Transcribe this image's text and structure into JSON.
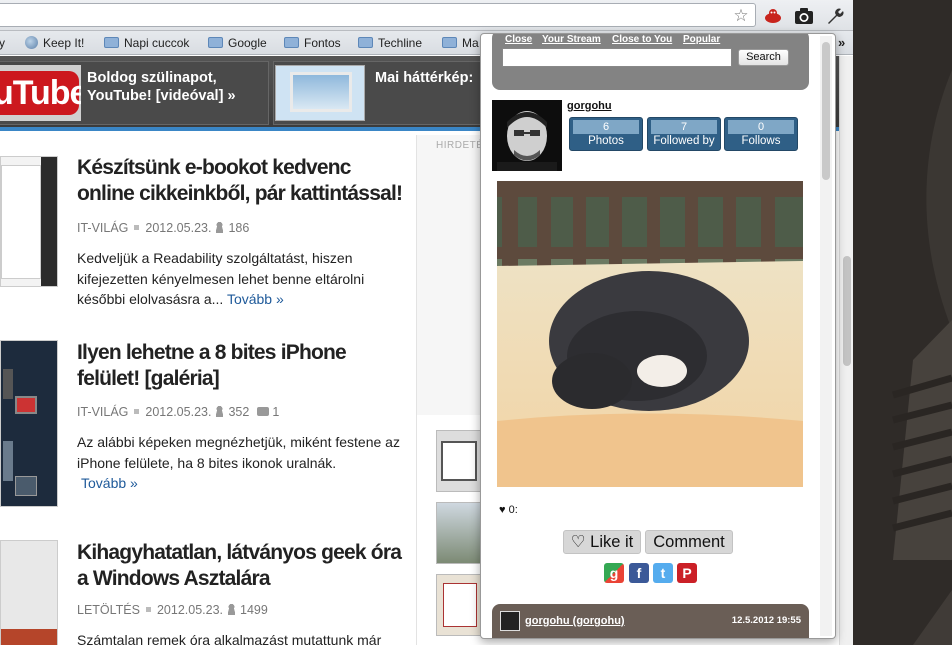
{
  "browser": {
    "bookmarks": [
      {
        "label": "y",
        "icon": "none"
      },
      {
        "label": "Keep It!",
        "icon": "globe-icon"
      },
      {
        "label": "Napi cuccok",
        "icon": "folder-icon"
      },
      {
        "label": "Google",
        "icon": "folder-icon"
      },
      {
        "label": "Fontos",
        "icon": "folder-icon"
      },
      {
        "label": "Techline",
        "icon": "folder-icon"
      },
      {
        "label": "Ma",
        "icon": "folder-icon"
      }
    ],
    "bookmarks_more": "»"
  },
  "featured": {
    "item1_title": "Boldog szülinapot, YouTube! [videóval] »",
    "item1_logo_text": "uTube",
    "item2_title": "Mai háttérkép:"
  },
  "articles": [
    {
      "title": "Készítsünk e-bookot kedvenc online cikkeinkből, pár kattintással!",
      "category": "IT-VILÁG",
      "date": "2012.05.23.",
      "views": "186",
      "comments": "",
      "body": "Kedveljük a Readability szolgáltatást, hiszen kifejezetten kényelmesen lehet benne eltárolni későbbi elolvasásra a...",
      "more": "Tovább »"
    },
    {
      "title": "Ilyen lehetne a 8 bites iPhone felület! [galéria]",
      "category": "IT-VILÁG",
      "date": "2012.05.23.",
      "views": "352",
      "comments": "1",
      "body": "Az alábbi képeken megnézhetjük, miként festene az iPhone felülete, ha 8 bites ikonok uralnák.",
      "more": "Tovább »"
    },
    {
      "title": "Kihagyhatatlan, látványos geek óra a Windows Asztalára",
      "category": "LETÖLTÉS",
      "date": "2012.05.23.",
      "views": "1499",
      "comments": "",
      "body": "Számtalan remek óra alkalmazást mutattunk már",
      "more": ""
    }
  ],
  "sidebar": {
    "ad_label": "HIRDETÉ"
  },
  "popup": {
    "nav": [
      "Close",
      "Your Stream",
      "Close to You",
      "Popular"
    ],
    "search_button": "Search",
    "search_value": "",
    "username": "gorgohu",
    "stats": [
      {
        "count": "6",
        "label": "Photos"
      },
      {
        "count": "7",
        "label": "Followed by"
      },
      {
        "count": "0",
        "label": "Follows"
      }
    ],
    "likes_count": "0:",
    "like_button": "Like it",
    "comment_button": "Comment",
    "share_icons": [
      "google-icon",
      "facebook-icon",
      "twitter-icon",
      "pinterest-icon"
    ],
    "comment": {
      "user": "gorgohu (gorgohu)",
      "date": "12.5.2012 19:55"
    }
  },
  "colors": {
    "accent_blue": "#3a86c6",
    "stat_blue": "#2f5f86",
    "popup_header_gray": "#838383",
    "comment_bar": "#6a5e56"
  }
}
